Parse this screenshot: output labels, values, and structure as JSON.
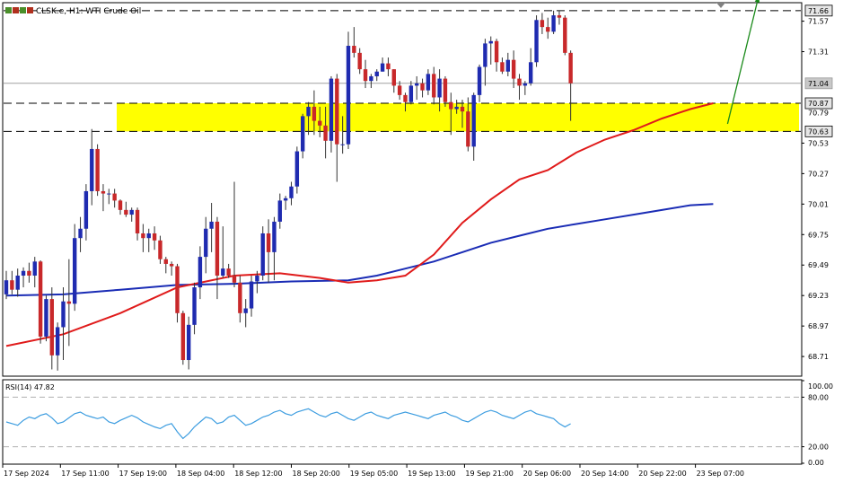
{
  "header": {
    "symbol_title": "CLSK.e, H1: WTI Crude Oil",
    "icon": "chart-window-icons"
  },
  "rsi_panel": {
    "label": "RSI(14) 47.82"
  },
  "colors": {
    "bull_candle": "#1f2bb0",
    "bear_candle": "#c8282a",
    "ma_fast": "#e01b1b",
    "ma_slow": "#1a2cb5",
    "zone_fill": "#ffff00",
    "rsi_line": "#3d9de0",
    "arrow": "#1a8a1a",
    "price_tag": "#d0d0d0"
  },
  "chart_data": {
    "type": "candlestick",
    "title": "CLSK.e, H1: WTI Crude Oil",
    "y_ticks": [
      "71.57",
      "71.31",
      "70.53",
      "70.27",
      "70.01",
      "69.75",
      "69.49",
      "69.23",
      "68.97",
      "68.71"
    ],
    "ylim": [
      68.55,
      71.72
    ],
    "price_tags": [
      {
        "value": 71.66,
        "label": "71.66",
        "style": "dark"
      },
      {
        "value": 71.04,
        "label": "71.04",
        "style": "gray"
      },
      {
        "value": 70.87,
        "label": "70.87",
        "style": "dark"
      },
      {
        "value": 70.79,
        "label": "70.79",
        "style": "plain"
      },
      {
        "value": 70.63,
        "label": "70.63",
        "style": "dark"
      }
    ],
    "x_labels": [
      "17 Sep 2024",
      "17 Sep 11:00",
      "17 Sep 19:00",
      "18 Sep 04:00",
      "18 Sep 12:00",
      "18 Sep 20:00",
      "19 Sep 05:00",
      "19 Sep 13:00",
      "19 Sep 21:00",
      "20 Sep 06:00",
      "20 Sep 14:00",
      "20 Sep 22:00",
      "23 Sep 07:00"
    ],
    "support_zone": [
      70.63,
      70.87
    ],
    "dashed_levels": [
      71.66,
      70.87,
      70.63
    ],
    "candles": [
      {
        "o": 69.24,
        "h": 69.44,
        "l": 69.2,
        "c": 69.36
      },
      {
        "o": 69.36,
        "h": 69.44,
        "l": 69.24,
        "c": 69.28
      },
      {
        "o": 69.28,
        "h": 69.46,
        "l": 69.22,
        "c": 69.4
      },
      {
        "o": 69.4,
        "h": 69.47,
        "l": 69.3,
        "c": 69.44
      },
      {
        "o": 69.44,
        "h": 69.51,
        "l": 69.34,
        "c": 69.4
      },
      {
        "o": 69.4,
        "h": 69.56,
        "l": 69.3,
        "c": 69.52
      },
      {
        "o": 69.52,
        "h": 69.53,
        "l": 68.82,
        "c": 68.88
      },
      {
        "o": 68.88,
        "h": 69.23,
        "l": 68.84,
        "c": 69.2
      },
      {
        "o": 69.2,
        "h": 69.3,
        "l": 68.6,
        "c": 68.72
      },
      {
        "o": 68.72,
        "h": 69.0,
        "l": 68.59,
        "c": 68.96
      },
      {
        "o": 68.96,
        "h": 69.3,
        "l": 68.68,
        "c": 69.18
      },
      {
        "o": 69.18,
        "h": 69.54,
        "l": 68.8,
        "c": 69.16
      },
      {
        "o": 69.16,
        "h": 69.84,
        "l": 69.1,
        "c": 69.72
      },
      {
        "o": 69.72,
        "h": 69.9,
        "l": 69.6,
        "c": 69.8
      },
      {
        "o": 69.8,
        "h": 70.18,
        "l": 69.7,
        "c": 70.12
      },
      {
        "o": 70.12,
        "h": 70.65,
        "l": 70.0,
        "c": 70.48
      },
      {
        "o": 70.48,
        "h": 70.52,
        "l": 70.08,
        "c": 70.12
      },
      {
        "o": 70.12,
        "h": 70.18,
        "l": 69.95,
        "c": 70.1
      },
      {
        "o": 70.1,
        "h": 70.14,
        "l": 70.01,
        "c": 70.1
      },
      {
        "o": 70.1,
        "h": 70.14,
        "l": 69.98,
        "c": 70.04
      },
      {
        "o": 70.04,
        "h": 70.05,
        "l": 69.92,
        "c": 69.96
      },
      {
        "o": 69.96,
        "h": 70.03,
        "l": 69.9,
        "c": 69.92
      },
      {
        "o": 69.92,
        "h": 69.98,
        "l": 69.86,
        "c": 69.96
      },
      {
        "o": 69.96,
        "h": 69.98,
        "l": 69.7,
        "c": 69.76
      },
      {
        "o": 69.76,
        "h": 69.84,
        "l": 69.6,
        "c": 69.72
      },
      {
        "o": 69.72,
        "h": 69.8,
        "l": 69.6,
        "c": 69.76
      },
      {
        "o": 69.76,
        "h": 69.82,
        "l": 69.62,
        "c": 69.7
      },
      {
        "o": 69.7,
        "h": 69.74,
        "l": 69.5,
        "c": 69.54
      },
      {
        "o": 69.54,
        "h": 69.56,
        "l": 69.42,
        "c": 69.5
      },
      {
        "o": 69.5,
        "h": 69.52,
        "l": 69.4,
        "c": 69.48
      },
      {
        "o": 69.48,
        "h": 69.5,
        "l": 69.0,
        "c": 69.08
      },
      {
        "o": 69.08,
        "h": 69.1,
        "l": 68.64,
        "c": 68.68
      },
      {
        "o": 68.68,
        "h": 69.05,
        "l": 68.6,
        "c": 68.98
      },
      {
        "o": 68.98,
        "h": 69.34,
        "l": 68.9,
        "c": 69.3
      },
      {
        "o": 69.3,
        "h": 69.65,
        "l": 69.2,
        "c": 69.56
      },
      {
        "o": 69.56,
        "h": 69.9,
        "l": 69.42,
        "c": 69.8
      },
      {
        "o": 69.8,
        "h": 70.02,
        "l": 69.6,
        "c": 69.86
      },
      {
        "o": 69.86,
        "h": 69.9,
        "l": 69.2,
        "c": 69.4
      },
      {
        "o": 69.4,
        "h": 69.82,
        "l": 69.38,
        "c": 69.46
      },
      {
        "o": 69.46,
        "h": 69.5,
        "l": 69.38,
        "c": 69.4
      },
      {
        "o": 69.4,
        "h": 70.2,
        "l": 69.3,
        "c": 69.34
      },
      {
        "o": 69.34,
        "h": 69.4,
        "l": 69.0,
        "c": 69.08
      },
      {
        "o": 69.08,
        "h": 69.2,
        "l": 68.96,
        "c": 69.12
      },
      {
        "o": 69.12,
        "h": 69.4,
        "l": 69.05,
        "c": 69.35
      },
      {
        "o": 69.35,
        "h": 69.44,
        "l": 69.25,
        "c": 69.4
      },
      {
        "o": 69.4,
        "h": 69.82,
        "l": 69.36,
        "c": 69.76
      },
      {
        "o": 69.76,
        "h": 69.88,
        "l": 69.34,
        "c": 69.6
      },
      {
        "o": 69.6,
        "h": 69.9,
        "l": 69.36,
        "c": 69.86
      },
      {
        "o": 69.86,
        "h": 70.1,
        "l": 69.8,
        "c": 70.04
      },
      {
        "o": 70.04,
        "h": 70.08,
        "l": 69.96,
        "c": 70.06
      },
      {
        "o": 70.06,
        "h": 70.2,
        "l": 70.0,
        "c": 70.16
      },
      {
        "o": 70.16,
        "h": 70.5,
        "l": 70.1,
        "c": 70.46
      },
      {
        "o": 70.46,
        "h": 70.78,
        "l": 70.4,
        "c": 70.76
      },
      {
        "o": 70.76,
        "h": 70.88,
        "l": 70.6,
        "c": 70.84
      },
      {
        "o": 70.84,
        "h": 70.98,
        "l": 70.6,
        "c": 70.72
      },
      {
        "o": 70.72,
        "h": 70.84,
        "l": 70.58,
        "c": 70.68
      },
      {
        "o": 70.68,
        "h": 70.84,
        "l": 70.4,
        "c": 70.55
      },
      {
        "o": 70.55,
        "h": 71.1,
        "l": 70.45,
        "c": 71.08
      },
      {
        "o": 71.08,
        "h": 71.12,
        "l": 70.2,
        "c": 70.52
      },
      {
        "o": 70.52,
        "h": 70.76,
        "l": 70.44,
        "c": 70.52
      },
      {
        "o": 70.52,
        "h": 71.48,
        "l": 70.48,
        "c": 71.36
      },
      {
        "o": 71.36,
        "h": 71.52,
        "l": 71.26,
        "c": 71.3
      },
      {
        "o": 71.3,
        "h": 71.34,
        "l": 71.12,
        "c": 71.16
      },
      {
        "o": 71.16,
        "h": 71.24,
        "l": 71.0,
        "c": 71.06
      },
      {
        "o": 71.06,
        "h": 71.12,
        "l": 71.0,
        "c": 71.1
      },
      {
        "o": 71.1,
        "h": 71.16,
        "l": 71.06,
        "c": 71.14
      },
      {
        "o": 71.14,
        "h": 71.26,
        "l": 71.16,
        "c": 71.21
      },
      {
        "o": 71.21,
        "h": 71.26,
        "l": 71.1,
        "c": 71.16
      },
      {
        "o": 71.16,
        "h": 71.14,
        "l": 70.96,
        "c": 71.02
      },
      {
        "o": 71.02,
        "h": 71.06,
        "l": 70.9,
        "c": 70.94
      },
      {
        "o": 70.94,
        "h": 70.96,
        "l": 70.8,
        "c": 70.88
      },
      {
        "o": 70.88,
        "h": 71.06,
        "l": 70.86,
        "c": 71.02
      },
      {
        "o": 71.02,
        "h": 71.1,
        "l": 70.9,
        "c": 71.04
      },
      {
        "o": 71.04,
        "h": 71.08,
        "l": 70.92,
        "c": 70.98
      },
      {
        "o": 70.98,
        "h": 71.16,
        "l": 70.94,
        "c": 71.12
      },
      {
        "o": 71.12,
        "h": 71.18,
        "l": 70.86,
        "c": 70.92
      },
      {
        "o": 70.92,
        "h": 71.16,
        "l": 70.8,
        "c": 71.08
      },
      {
        "o": 71.08,
        "h": 71.1,
        "l": 70.84,
        "c": 70.88
      },
      {
        "o": 70.88,
        "h": 70.96,
        "l": 70.6,
        "c": 70.82
      },
      {
        "o": 70.82,
        "h": 70.9,
        "l": 70.78,
        "c": 70.84
      },
      {
        "o": 70.84,
        "h": 70.9,
        "l": 70.66,
        "c": 70.8
      },
      {
        "o": 70.8,
        "h": 70.92,
        "l": 70.46,
        "c": 70.5
      },
      {
        "o": 70.5,
        "h": 70.96,
        "l": 70.38,
        "c": 70.94
      },
      {
        "o": 70.94,
        "h": 71.2,
        "l": 70.88,
        "c": 71.18
      },
      {
        "o": 71.18,
        "h": 71.42,
        "l": 71.02,
        "c": 71.38
      },
      {
        "o": 71.38,
        "h": 71.44,
        "l": 71.2,
        "c": 71.4
      },
      {
        "o": 71.4,
        "h": 71.42,
        "l": 71.14,
        "c": 71.22
      },
      {
        "o": 71.22,
        "h": 71.26,
        "l": 71.12,
        "c": 71.14
      },
      {
        "o": 71.14,
        "h": 71.3,
        "l": 71.1,
        "c": 71.24
      },
      {
        "o": 71.24,
        "h": 71.32,
        "l": 71.0,
        "c": 71.08
      },
      {
        "o": 71.08,
        "h": 71.12,
        "l": 70.9,
        "c": 71.02
      },
      {
        "o": 71.02,
        "h": 71.06,
        "l": 70.94,
        "c": 71.04
      },
      {
        "o": 71.04,
        "h": 71.34,
        "l": 71.02,
        "c": 71.22
      },
      {
        "o": 71.22,
        "h": 71.62,
        "l": 71.18,
        "c": 71.58
      },
      {
        "o": 71.58,
        "h": 71.64,
        "l": 71.46,
        "c": 71.52
      },
      {
        "o": 71.52,
        "h": 71.6,
        "l": 71.42,
        "c": 71.48
      },
      {
        "o": 71.48,
        "h": 71.66,
        "l": 71.46,
        "c": 71.62
      },
      {
        "o": 71.62,
        "h": 71.66,
        "l": 71.54,
        "c": 71.6
      },
      {
        "o": 71.6,
        "h": 71.62,
        "l": 71.28,
        "c": 71.3
      },
      {
        "o": 71.3,
        "h": 71.32,
        "l": 70.72,
        "c": 71.04
      }
    ],
    "ma_fast_points": [
      [
        0,
        68.8
      ],
      [
        10,
        68.9
      ],
      [
        20,
        69.08
      ],
      [
        30,
        69.3
      ],
      [
        40,
        69.4
      ],
      [
        48,
        69.42
      ],
      [
        55,
        69.38
      ],
      [
        60,
        69.34
      ],
      [
        65,
        69.36
      ],
      [
        70,
        69.4
      ],
      [
        75,
        69.58
      ],
      [
        80,
        69.85
      ],
      [
        85,
        70.05
      ],
      [
        90,
        70.22
      ],
      [
        95,
        70.3
      ],
      [
        100,
        70.45
      ],
      [
        105,
        70.56
      ],
      [
        110,
        70.64
      ],
      [
        115,
        70.74
      ],
      [
        120,
        70.82
      ],
      [
        124,
        70.87
      ]
    ],
    "ma_slow_points": [
      [
        0,
        69.23
      ],
      [
        10,
        69.24
      ],
      [
        20,
        69.28
      ],
      [
        30,
        69.32
      ],
      [
        40,
        69.33
      ],
      [
        50,
        69.35
      ],
      [
        60,
        69.36
      ],
      [
        65,
        69.4
      ],
      [
        70,
        69.46
      ],
      [
        75,
        69.52
      ],
      [
        80,
        69.6
      ],
      [
        85,
        69.68
      ],
      [
        90,
        69.74
      ],
      [
        95,
        69.8
      ],
      [
        100,
        69.84
      ],
      [
        105,
        69.88
      ],
      [
        110,
        69.92
      ],
      [
        115,
        69.96
      ],
      [
        120,
        70.0
      ],
      [
        124,
        70.01
      ]
    ],
    "rsi": {
      "value": 47.82,
      "ylim": [
        0,
        100
      ],
      "ticks": [
        "100.00",
        "80.00",
        "20.00",
        "0.00"
      ],
      "levels": [
        80,
        20
      ],
      "points": [
        50,
        48,
        46,
        52,
        56,
        54,
        58,
        60,
        55,
        48,
        50,
        55,
        60,
        62,
        58,
        56,
        54,
        56,
        50,
        48,
        52,
        55,
        58,
        55,
        50,
        47,
        44,
        42,
        46,
        48,
        38,
        30,
        36,
        44,
        50,
        56,
        54,
        48,
        50,
        56,
        58,
        52,
        46,
        48,
        52,
        56,
        58,
        62,
        64,
        60,
        58,
        62,
        64,
        66,
        62,
        58,
        56,
        60,
        62,
        58,
        54,
        52,
        56,
        60,
        62,
        58,
        56,
        54,
        58,
        60,
        62,
        60,
        58,
        56,
        54,
        58,
        60,
        62,
        58,
        56,
        52,
        50,
        54,
        58,
        62,
        64,
        62,
        58,
        56,
        54,
        58,
        62,
        64,
        60,
        58,
        56,
        54,
        48,
        44,
        47.82
      ]
    },
    "arrow": {
      "from": [
        71.0,
        124
      ],
      "to": [
        71.62,
        132
      ]
    }
  }
}
